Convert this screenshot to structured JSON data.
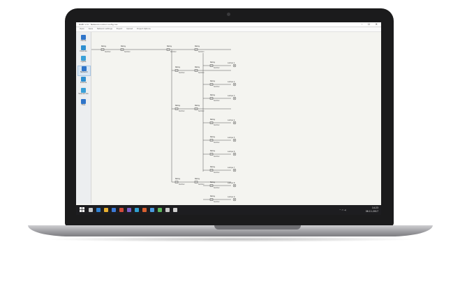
{
  "window": {
    "title": "RUBY 2.0 - Networkcontrol config.mlr",
    "controls": "– ☐ ✕"
  },
  "toolbar": {
    "items": [
      "Open",
      "Save",
      "Network settings",
      "Export",
      "Upload",
      "Project Options"
    ]
  },
  "sidebar": {
    "items": [
      {
        "label": "Home",
        "color": "#2e74c9"
      },
      {
        "label": "Devices",
        "color": "#2e8fd0"
      },
      {
        "label": "Lights",
        "color": "#3aa0d8"
      },
      {
        "label": "Network",
        "color": "#2e74c9",
        "active": true
      },
      {
        "label": "Scenes",
        "color": "#2e8fd0"
      },
      {
        "label": "Sequences",
        "color": "#3aa0d8"
      },
      {
        "label": "Files",
        "color": "#2e74c9"
      }
    ]
  },
  "diagram": {
    "node_label": "Relay",
    "device_label": "Netzteil",
    "device_labels": [
      "Lampe 1",
      "Lampe 2",
      "Lampe 3",
      "Lampe 4",
      "Lampe 5",
      "Lampe 6",
      "Lampe 7",
      "Lampe 8",
      "Lampe 9"
    ]
  },
  "taskbar": {
    "time": "14:23",
    "date": "06.11.2017",
    "icon_colors": [
      "#c8c8c8",
      "#2f80d0",
      "#e8b030",
      "#3c7ad8",
      "#d24a3a",
      "#7a5ec8",
      "#2fa0d0",
      "#d86030",
      "#4a9ae0",
      "#5cb85c",
      "#c8c8c8",
      "#d0d0d0"
    ]
  }
}
